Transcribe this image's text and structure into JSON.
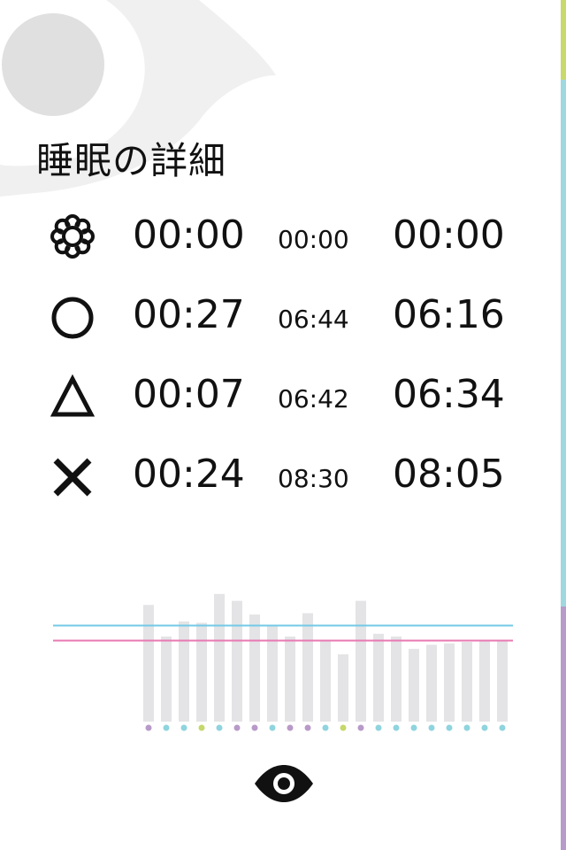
{
  "title": "睡眠の詳細",
  "colors": {
    "accent_blue": "#74c9e6",
    "accent_pink": "#e879b1",
    "bar_gray": "#e4e4e6",
    "dot_purple": "#b89ac9",
    "dot_cyan": "#8fd4de",
    "dot_green": "#c5d86b",
    "strip_green": "#c9d96a",
    "strip_cyan": "#9fd8de",
    "strip_purple": "#b79ccb"
  },
  "rows": [
    {
      "icon": "flower-icon",
      "total": "00:00",
      "mid": "00:00",
      "end": "00:00"
    },
    {
      "icon": "circle-icon",
      "total": "00:27",
      "mid": "06:44",
      "end": "06:16"
    },
    {
      "icon": "triangle-icon",
      "total": "00:07",
      "mid": "06:42",
      "end": "06:34"
    },
    {
      "icon": "cross-icon",
      "total": "00:24",
      "mid": "08:30",
      "end": "08:05"
    }
  ],
  "chart_data": {
    "type": "bar",
    "values": [
      0.85,
      0.62,
      0.73,
      0.72,
      0.93,
      0.88,
      0.78,
      0.7,
      0.62,
      0.79,
      0.59,
      0.49,
      0.88,
      0.64,
      0.62,
      0.53,
      0.56,
      0.57,
      0.58,
      0.59,
      0.59
    ],
    "dots": [
      "purple",
      "cyan",
      "cyan",
      "green",
      "cyan",
      "purple",
      "purple",
      "cyan",
      "purple",
      "purple",
      "cyan",
      "green",
      "purple",
      "cyan",
      "cyan",
      "cyan",
      "cyan",
      "cyan",
      "cyan",
      "cyan",
      "cyan"
    ],
    "reference_lines": [
      {
        "name": "blue",
        "value": 0.7
      },
      {
        "name": "pink",
        "value": 0.59
      }
    ],
    "ylim": [
      0,
      1
    ]
  },
  "eye_button": {
    "icon": "eye-icon"
  }
}
